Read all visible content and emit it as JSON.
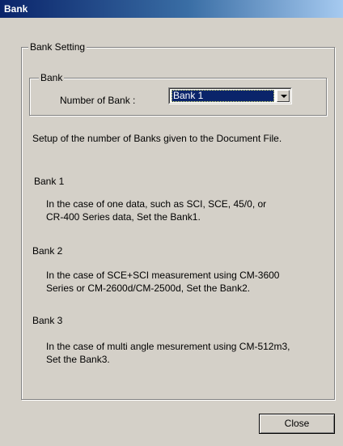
{
  "window": {
    "title": "Bank"
  },
  "bank_setting": {
    "legend": "Bank Setting",
    "bank_group": {
      "legend": "Bank",
      "number_label": "Number of Bank :",
      "selected": "Bank 1"
    },
    "description": "Setup of the number of Banks given to the Document File.",
    "banks": [
      {
        "heading": "Bank 1",
        "lines": [
          "In the case of one data, such as SCI, SCE, 45/0, or",
          "CR-400 Series data, Set the Bank1."
        ]
      },
      {
        "heading": "Bank 2",
        "lines": [
          "In the case of SCE+SCI measurement using CM-3600",
          "Series or CM-2600d/CM-2500d, Set the Bank2."
        ]
      },
      {
        "heading": "Bank 3",
        "lines": [
          "In the case of multi angle mesurement using CM-512m3,",
          "Set the Bank3."
        ]
      }
    ]
  },
  "close_label": "Close"
}
